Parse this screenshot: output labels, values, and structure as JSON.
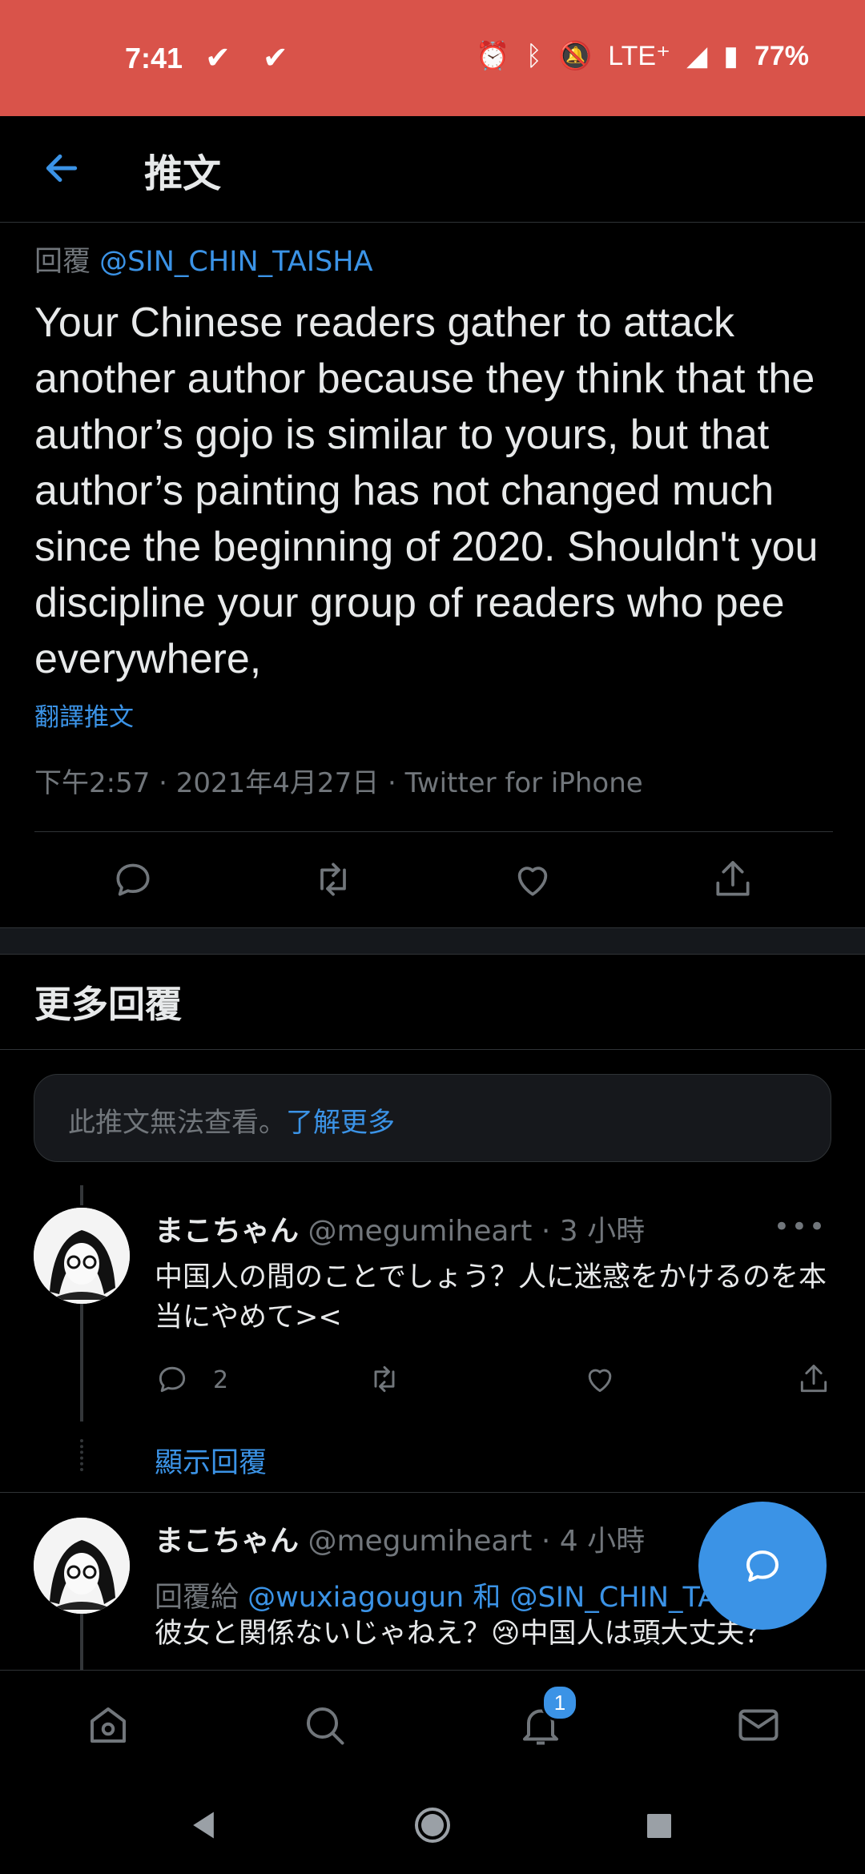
{
  "status_bar": {
    "time": "7:41",
    "checks": "✔ ✔",
    "network": "LTE⁺",
    "battery": "77%"
  },
  "header": {
    "title": "推文"
  },
  "tweet": {
    "reply_prefix": "回覆",
    "reply_handle": "@SIN_CHIN_TAISHA",
    "text": "Your Chinese readers gather to attack another author because they think that the author’s gojo is similar to yours, but that author’s painting has not changed much since the beginning of 2020. Shouldn't you discipline your group of readers who pee everywhere,",
    "translate": "翻譯推文",
    "meta": "下午2:57 · 2021年4月27日 · Twitter for iPhone"
  },
  "more_replies": {
    "header": "更多回覆",
    "unavailable_text": "此推文無法查看。",
    "learn_more": "了解更多"
  },
  "replies": [
    {
      "name": "まこちゃん",
      "handle": "@megumiheart",
      "time": "· 3 小時",
      "text": "中国人の間のことでしょう？人に迷惑をかけるのを本当にやめて><",
      "reply_count": "2",
      "show_replies": "顯示回覆"
    },
    {
      "name": "まこちゃん",
      "handle": "@megumiheart",
      "time": "· 4 小時",
      "reply_prefix": "回覆給",
      "reply_handle_1": "@wuxiagougun",
      "reply_and": "和",
      "reply_handle_2": "@SIN_CHIN_TAI",
      "text": "彼女と関係ないじゃねえ？😢中国人は頭大丈夫？"
    }
  ],
  "bottom_nav": {
    "notifications_badge": "1"
  },
  "colors": {
    "accent": "#3b93e6",
    "status_bar": "#d9534a",
    "background": "#000000"
  }
}
